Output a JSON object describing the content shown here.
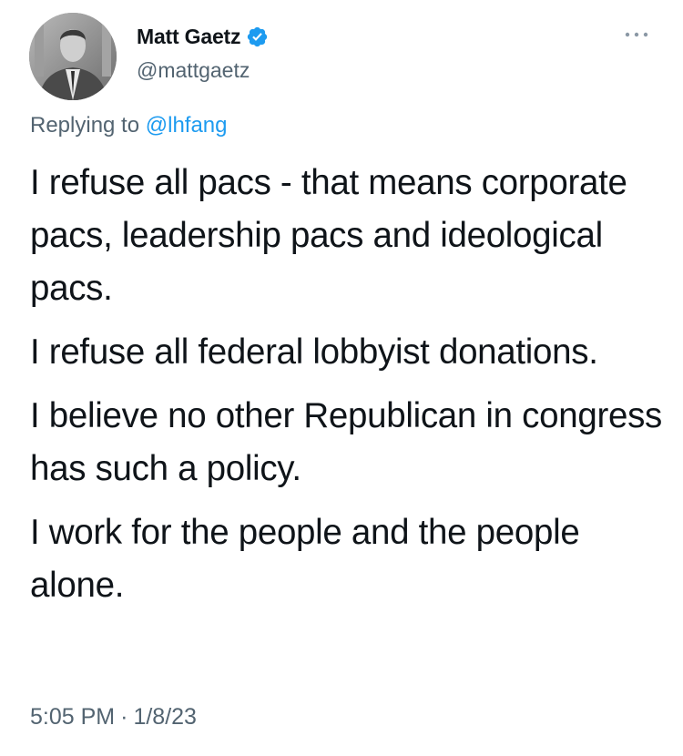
{
  "author": {
    "name": "Matt Gaetz",
    "handle": "@mattgaetz",
    "verified": true,
    "avatar_icon": "profile-photo"
  },
  "menu": {
    "icon": "more-dots-icon"
  },
  "reply": {
    "prefix": "Replying to",
    "target": "@lhfang"
  },
  "tweet": {
    "paragraphs": [
      "I refuse all pacs - that means corporate pacs, leadership pacs and ideological pacs.",
      "I refuse all federal lobbyist donations.",
      "I believe no other Republican in congress has such a policy.",
      "I work for the people and the people alone."
    ]
  },
  "meta": {
    "time": "5:05 PM",
    "separator": "·",
    "date": "1/8/23"
  },
  "colors": {
    "text": "#0f1419",
    "secondary": "#536471",
    "link": "#1d9bf0",
    "verified": "#1d9bf0",
    "background": "#ffffff"
  }
}
